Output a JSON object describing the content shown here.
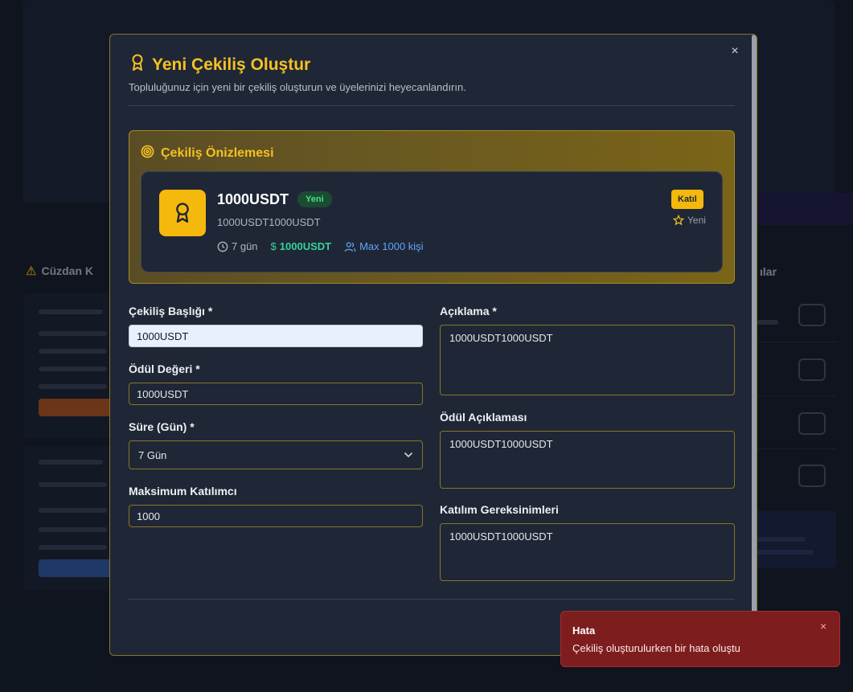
{
  "background": {
    "left_heading": "Cüzdan K",
    "right_heading": "ılar"
  },
  "modal": {
    "title": "Yeni Çekiliş Oluştur",
    "subtitle": "Topluluğunuz için yeni bir çekiliş oluşturun ve üyelerinizi heyecanlandırın.",
    "close_label": "×"
  },
  "preview": {
    "heading": "Çekiliş Önizlemesi",
    "card": {
      "title": "1000USDT",
      "badge": "Yeni",
      "description": "1000USDT1000USDT",
      "days": "7 gün",
      "prize": "1000USDT",
      "max": "Max 1000 kişi",
      "join_label": "Katıl",
      "status": "Yeni"
    }
  },
  "form": {
    "title_label": "Çekiliş Başlığı *",
    "title_value": "1000USDT",
    "prize_label": "Ödül Değeri *",
    "prize_value": "1000USDT",
    "duration_label": "Süre (Gün) *",
    "duration_value": "7 Gün",
    "max_label": "Maksimum Katılımcı",
    "max_value": "1000",
    "description_label": "Açıklama *",
    "description_value": "1000USDT1000USDT",
    "prize_desc_label": "Ödül Açıklaması",
    "prize_desc_value": "1000USDT1000USDT",
    "requirements_label": "Katılım Gereksinimleri",
    "requirements_value": "1000USDT1000USDT"
  },
  "toast": {
    "title": "Hata",
    "message": "Çekiliş oluşturulurken bir hata oluştu",
    "close_label": "×"
  },
  "colors": {
    "accent": "#f5c121",
    "modal_bg": "#1f2736",
    "error_bg": "#7e1d1d",
    "success": "#34d399",
    "info": "#60a5fa"
  },
  "icons": [
    "award-icon",
    "target-icon",
    "clock-icon",
    "dollar-icon",
    "users-icon",
    "star-icon",
    "chevron-down-icon",
    "close-icon",
    "warning-icon"
  ]
}
